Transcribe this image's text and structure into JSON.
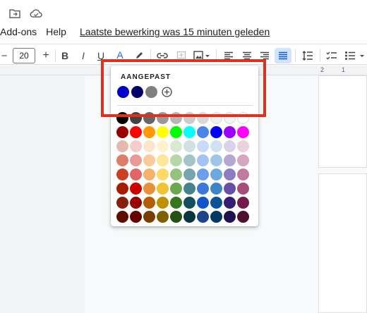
{
  "menu": {
    "addons": "Add-ons",
    "help": "Help",
    "last_edit": "Laatste bewerking was 15 minuten geleden"
  },
  "toolbar": {
    "minus": "−",
    "font_size": "20",
    "plus": "+",
    "bold": "B",
    "italic": "I",
    "underline": "U",
    "text_color": "A"
  },
  "ruler": {
    "mark_2": "2",
    "mark_1": "1"
  },
  "palette": {
    "custom_label": "AANGEPAST",
    "custom_colors": [
      "#0000c8",
      "#000066",
      "#7f7f7f"
    ],
    "rows": [
      [
        "#000000",
        "#434343",
        "#666666",
        "#999999",
        "#b7b7b7",
        "#cccccc",
        "#d9d9d9",
        "#efefef",
        "#f3f3f3",
        "#ffffff"
      ],
      [
        "#980000",
        "#ff0000",
        "#ff9900",
        "#ffff00",
        "#00ff00",
        "#00ffff",
        "#4a86e8",
        "#0000ff",
        "#9900ff",
        "#ff00ff"
      ],
      [
        "#e6b8af",
        "#f4cccc",
        "#fce5cd",
        "#fff2cc",
        "#d9ead3",
        "#d0e0e3",
        "#c9daf8",
        "#cfe2f3",
        "#d9d2e9",
        "#ead1dc"
      ],
      [
        "#dd7e6b",
        "#ea9999",
        "#f9cb9c",
        "#ffe599",
        "#b6d7a8",
        "#a2c4c9",
        "#a4c2f4",
        "#9fc5e8",
        "#b4a7d6",
        "#d5a6bd"
      ],
      [
        "#cc4125",
        "#e06666",
        "#f6b26b",
        "#ffd966",
        "#93c47d",
        "#76a5af",
        "#6d9eeb",
        "#6fa8dc",
        "#8e7cc3",
        "#c27ba0"
      ],
      [
        "#a61c00",
        "#cc0000",
        "#e69138",
        "#f1c232",
        "#6aa84f",
        "#45818e",
        "#3c78d8",
        "#3d85c6",
        "#674ea7",
        "#a64d79"
      ],
      [
        "#85200c",
        "#990000",
        "#b45f06",
        "#bf9000",
        "#38761d",
        "#134f5c",
        "#1155cc",
        "#0b5394",
        "#351c75",
        "#741b47"
      ],
      [
        "#5b0f00",
        "#660000",
        "#783f04",
        "#7f6000",
        "#274e13",
        "#0c343d",
        "#1c4587",
        "#073763",
        "#20124d",
        "#4c1130"
      ]
    ]
  },
  "colors": {
    "highlight": "#e03020",
    "text_color_bar": "#000000"
  }
}
